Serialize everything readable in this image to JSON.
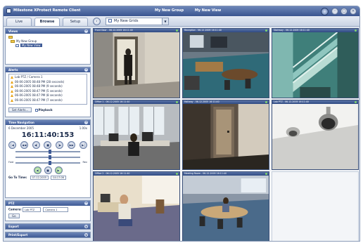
{
  "window": {
    "title": "Milestone XProtect Remote Client",
    "group": "My New Group",
    "view": "My New View",
    "minimize": "–",
    "maximize": "□",
    "close": "×"
  },
  "tabs": [
    {
      "label": "Live"
    },
    {
      "label": "Browse"
    },
    {
      "label": "Setup"
    }
  ],
  "view_selector": {
    "label": "My New Grids"
  },
  "views_panel": {
    "title": "Views",
    "group": "My New Group",
    "view": "My New View"
  },
  "alerts_panel": {
    "title": "Alerts",
    "items": [
      "Lab PTZ / Camera 1",
      "06-06-2005 08:48 PM (28 seconds)",
      "06-06-2005 08:48 PM (9 seconds)",
      "06-06-2005 08:47 PM (5 seconds)",
      "06-06-2005 08:47 PM (8 seconds)",
      "06-06-2005 08:47 PM (7 seconds)"
    ],
    "button_label": "Set Alerts...",
    "checkbox_label": "Playback"
  },
  "time_panel": {
    "title": "Time Navigation",
    "date": "6 December 2005",
    "speed": "1.00x",
    "time": "16:11:40:153",
    "slider_left": "Fwd",
    "slider_right": "Rev",
    "goto_label": "Go To Time:",
    "goto_date": "07-12-2005",
    "goto_time": "04:17:06"
  },
  "ptz_panel": {
    "title": "PTZ",
    "camera_label": "Camera:",
    "camera_value": "Lab PTZ",
    "camera_sub": "Camera 1",
    "go_label": "Go"
  },
  "export_panel": {
    "title": "Export"
  },
  "more_panel": {
    "title": "Print/Export"
  },
  "cameras": [
    {
      "name": "Front Door - 06-12-2005 16:11:40"
    },
    {
      "name": "Reception - 06-12-2005 16:11:40"
    },
    {
      "name": "Stairway - 06-12-2005 16:11:40"
    },
    {
      "name": "Office 1 - 06-12-2005 16:11:40"
    },
    {
      "name": "Hallway - 06-12-2005 16:11:40"
    },
    {
      "name": "Lab PTZ - 06-12-2005 16:11:40"
    },
    {
      "name": "Office 2 - 06-12-2005 16:11:40"
    },
    {
      "name": "Meeting Room - 06-12-2005 16:11:40"
    }
  ],
  "colors": {
    "title_bar": "#3a5590",
    "panel_head": "#3f5b96",
    "window_bg": "#dfe6f0",
    "accent": "#4c6aa6"
  }
}
